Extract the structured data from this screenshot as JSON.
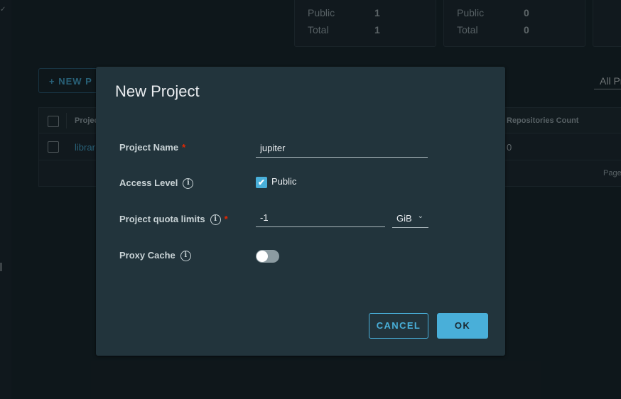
{
  "background": {
    "summary_cards": [
      {
        "rows": [
          {
            "label": "Public",
            "value": "1"
          },
          {
            "label": "Total",
            "value": "1"
          }
        ]
      },
      {
        "rows": [
          {
            "label": "Public",
            "value": "0"
          },
          {
            "label": "Total",
            "value": "0"
          }
        ]
      }
    ],
    "new_project_button": "+ NEW P",
    "filter_select": "All Pr",
    "table": {
      "columns": [
        "Projec",
        "Repositories Count"
      ],
      "rows": [
        {
          "name": "librar",
          "repositories_count": "0"
        }
      ],
      "footer": "Page si"
    }
  },
  "modal": {
    "title": "New Project",
    "fields": {
      "project_name": {
        "label": "Project Name",
        "required_mark": "*",
        "value": "jupiter"
      },
      "access_level": {
        "label": "Access Level",
        "checkbox_label": "Public",
        "checked": true
      },
      "quota": {
        "label": "Project quota limits",
        "required_mark": "*",
        "value": "-1",
        "unit": "GiB"
      },
      "proxy_cache": {
        "label": "Proxy Cache",
        "enabled": false
      }
    },
    "buttons": {
      "cancel": "CANCEL",
      "ok": "OK"
    }
  },
  "icons": {
    "info": "i",
    "check": "✔",
    "chevron": "⌄"
  },
  "colors": {
    "accent": "#49afd9",
    "required": "#e62700",
    "modal_bg": "#22343c"
  }
}
